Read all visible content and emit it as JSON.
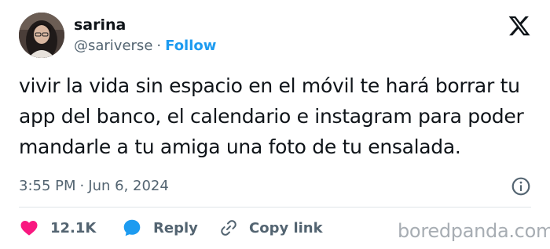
{
  "author": {
    "name": "sarina",
    "handle": "@sariverse",
    "separator": "·",
    "follow_label": "Follow"
  },
  "tweet": {
    "lines": [
      "vivir la vida sin espacio en el móvil te hará borrar tu",
      "app del banco, el calendario e instagram para poder",
      "mandarle a tu amiga una foto de tu ensalada."
    ],
    "time": "3:55 PM",
    "separator": "·",
    "date": "Jun 6, 2024"
  },
  "actions": {
    "like_count": "12.1K",
    "reply_label": "Reply",
    "copy_link_label": "Copy link"
  },
  "watermark": "boredpanda.com",
  "icons": {
    "x_logo": "x-logo-icon",
    "info": "info-icon",
    "heart": "heart-icon",
    "reply": "reply-bubble-icon",
    "link": "link-icon"
  },
  "colors": {
    "like": "#f91880",
    "reply": "#1d9bf0",
    "follow": "#1d9bf0",
    "secondary_text": "#536471"
  }
}
